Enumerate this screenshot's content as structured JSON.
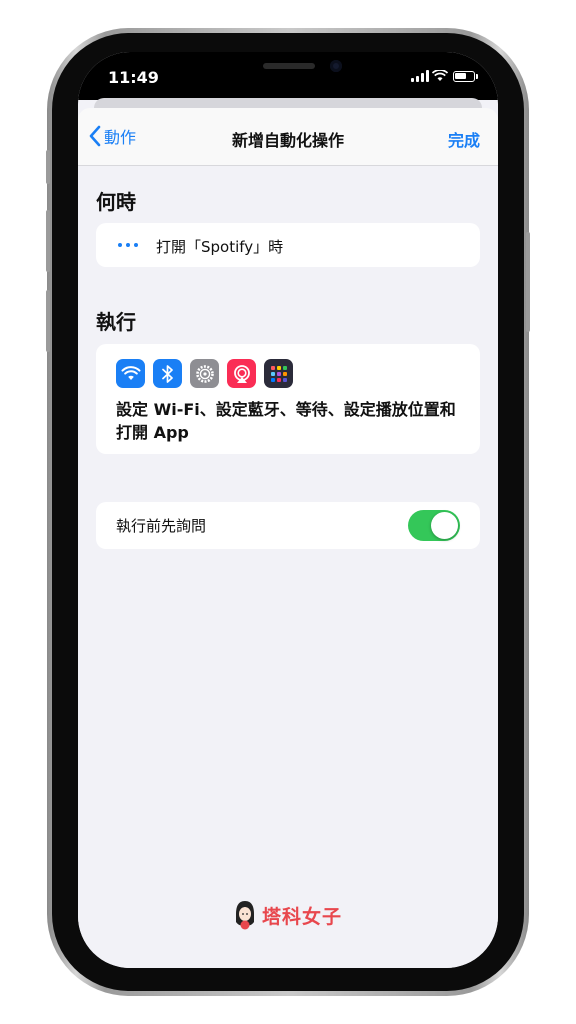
{
  "status_bar": {
    "time": "11:49"
  },
  "nav": {
    "back_label": "動作",
    "title": "新增自動化操作",
    "done_label": "完成"
  },
  "when_section": {
    "title": "何時",
    "trigger": "打開「Spotify」時"
  },
  "do_section": {
    "title": "執行",
    "icons": [
      "wifi-icon",
      "bluetooth-icon",
      "settings-gear-icon",
      "airplay-audio-icon",
      "apps-grid-icon"
    ],
    "summary": "設定 Wi-Fi、設定藍牙、等待、設定播放位置和打開 App"
  },
  "ask_before_running": {
    "label": "執行前先詢問",
    "enabled": true
  },
  "watermark": {
    "text": "塔科女子"
  },
  "colors": {
    "accent": "#1a7ff5",
    "toggle_on": "#34c759",
    "watermark": "#e8474d"
  }
}
